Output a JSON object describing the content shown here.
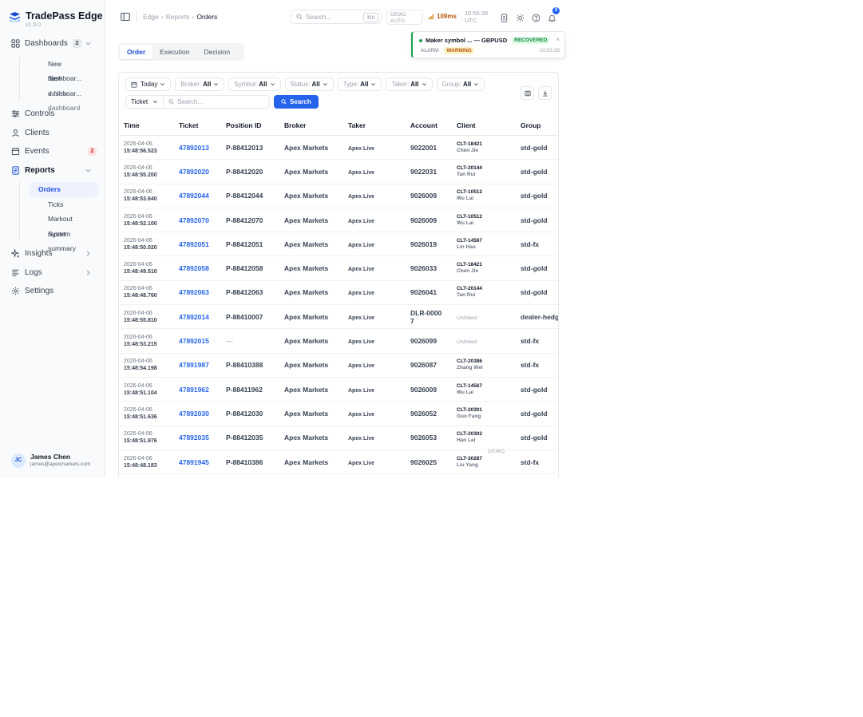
{
  "app": {
    "name": "TradePass Edge",
    "version": "v1.0.0",
    "accent": "#2563eb"
  },
  "sidebar": {
    "dashboards": {
      "label": "Dashboards",
      "badge": "2",
      "icon": "grid-icon",
      "items": [
        "New dashboar...",
        "New dashboar...",
        "+ New dashboard"
      ]
    },
    "items": [
      {
        "label": "Controls",
        "icon": "sliders-icon"
      },
      {
        "label": "Clients",
        "icon": "user-icon"
      },
      {
        "label": "Events",
        "icon": "calendar-icon",
        "badge": "2"
      }
    ],
    "reports": {
      "label": "Reports",
      "icon": "document-icon",
      "items": [
        "Orders",
        "Ticks",
        "Markout report",
        "System summary"
      ],
      "active": "Orders"
    },
    "bottom_items": [
      {
        "label": "Insights",
        "icon": "sparkle-icon"
      },
      {
        "label": "Logs",
        "icon": "list-icon"
      },
      {
        "label": "Settings",
        "icon": "gear-icon"
      }
    ],
    "user": {
      "initials": "JC",
      "name": "James Chen",
      "email": "james@apexmarkets.com"
    }
  },
  "topbar": {
    "breadcrumb": [
      "Edge",
      "Reports",
      "Orders"
    ],
    "search_placeholder": "Search...",
    "search_shortcut": "⌘K",
    "mode_line1": "DEMO ·",
    "mode_line2": "AUTO",
    "latency": "109ms",
    "clock_time": "10:56:38",
    "clock_zone": "UTC",
    "notification_count": "3"
  },
  "toast": {
    "title": "Maker symbol ... — GBPUSD",
    "status": "RECOVERED",
    "type": "ALARM",
    "severity": "WARNING",
    "time": "10:53:28",
    "close": "×"
  },
  "tabs": [
    "Order",
    "Execution",
    "Decision"
  ],
  "active_tab": "Order",
  "filters": {
    "date": "Today",
    "chips": [
      {
        "label": "Broker:",
        "value": "All"
      },
      {
        "label": "Symbol:",
        "value": "All"
      },
      {
        "label": "Status:",
        "value": "All"
      },
      {
        "label": "Type:",
        "value": "All"
      },
      {
        "label": "Taker:",
        "value": "All"
      },
      {
        "label": "Group:",
        "value": "All"
      }
    ],
    "search_field": "Ticket",
    "search_placeholder": "Search...",
    "search_button": "Search"
  },
  "table": {
    "columns": [
      "Time",
      "Ticket",
      "Position ID",
      "Broker",
      "Taker",
      "Account",
      "Client",
      "Group"
    ],
    "rows": [
      {
        "date": "2026-04-06",
        "time": "15:48:56.523",
        "ticket": "47892013",
        "position": "P-88412013",
        "broker": "Apex Markets",
        "taker": "Apex Live",
        "account": "9022001",
        "client_id": "CLT-18421",
        "client_name": "Chen Jie",
        "group": "std-gold"
      },
      {
        "date": "2026-04-06",
        "time": "15:48:55.200",
        "ticket": "47892020",
        "position": "P-88412020",
        "broker": "Apex Markets",
        "taker": "Apex Live",
        "account": "9022031",
        "client_id": "CLT-20144",
        "client_name": "Tan Rui",
        "group": "std-gold"
      },
      {
        "date": "2026-04-06",
        "time": "15:48:53.640",
        "ticket": "47892044",
        "position": "P-88412044",
        "broker": "Apex Markets",
        "taker": "Apex Live",
        "account": "9026009",
        "client_id": "CLT-10512",
        "client_name": "Wu Lai",
        "group": "std-gold"
      },
      {
        "date": "2026-04-06",
        "time": "15:48:52.100",
        "ticket": "47892070",
        "position": "P-88412070",
        "broker": "Apex Markets",
        "taker": "Apex Live",
        "account": "9026009",
        "client_id": "CLT-10512",
        "client_name": "Wu Lai",
        "group": "std-gold"
      },
      {
        "date": "2026-04-06",
        "time": "15:48:50.020",
        "ticket": "47892051",
        "position": "P-88412051",
        "broker": "Apex Markets",
        "taker": "Apex Live",
        "account": "9026019",
        "client_id": "CLT-14567",
        "client_name": "Lin Hao",
        "group": "std-fx"
      },
      {
        "date": "2026-04-06",
        "time": "15:48:49.510",
        "ticket": "47892058",
        "position": "P-88412058",
        "broker": "Apex Markets",
        "taker": "Apex Live",
        "account": "9026033",
        "client_id": "CLT-18421",
        "client_name": "Chen Jie",
        "group": "std-gold"
      },
      {
        "date": "2026-04-06",
        "time": "15:48:48.760",
        "ticket": "47892063",
        "position": "P-88412063",
        "broker": "Apex Markets",
        "taker": "Apex Live",
        "account": "9026041",
        "client_id": "CLT-20144",
        "client_name": "Tan Rui",
        "group": "std-gold"
      },
      {
        "date": "2026-04-06",
        "time": "15:48:55.810",
        "ticket": "47892014",
        "position": "P-88410007",
        "broker": "Apex Markets",
        "taker": "Apex Live",
        "account": "DLR-00007",
        "client_id": "",
        "client_name": "",
        "unlinked": "Unlinked",
        "group": "dealer-hedge"
      },
      {
        "date": "2026-04-06",
        "time": "15:48:53.215",
        "ticket": "47892015",
        "position": "—",
        "broker": "Apex Markets",
        "taker": "Apex Live",
        "account": "9026099",
        "client_id": "",
        "client_name": "",
        "unlinked": "Unlinked",
        "group": "std-fx"
      },
      {
        "date": "2026-04-06",
        "time": "15:48:54.198",
        "ticket": "47891987",
        "position": "P-88410388",
        "broker": "Apex Markets",
        "taker": "Apex Live",
        "account": "9026087",
        "client_id": "CLT-20386",
        "client_name": "Zhang Wei",
        "group": "std-fx"
      },
      {
        "date": "2026-04-06",
        "time": "15:48:51.104",
        "ticket": "47891962",
        "position": "P-88411962",
        "broker": "Apex Markets",
        "taker": "Apex Live",
        "account": "9026009",
        "client_id": "CLT-14567",
        "client_name": "Wu Lai",
        "group": "std-gold"
      },
      {
        "date": "2026-04-06",
        "time": "15:48:51.636",
        "ticket": "47892030",
        "position": "P-88412030",
        "broker": "Apex Markets",
        "taker": "Apex Live",
        "account": "9026052",
        "client_id": "CLT-20301",
        "client_name": "Guo Fang",
        "group": "std-gold"
      },
      {
        "date": "2026-04-06",
        "time": "15:48:51.976",
        "ticket": "47892035",
        "position": "P-88412035",
        "broker": "Apex Markets",
        "taker": "Apex Live",
        "account": "9026053",
        "client_id": "CLT-20302",
        "client_name": "Han Lei",
        "group": "std-gold"
      },
      {
        "date": "2026-04-06",
        "time": "15:48:48.183",
        "ticket": "47891945",
        "position": "P-88410386",
        "broker": "Apex Markets",
        "taker": "Apex Live",
        "account": "9026025",
        "client_id": "CLT-30287",
        "client_name": "Liu Yang",
        "group": "std-fx"
      },
      {
        "date": "2026-04-06",
        "time": "",
        "ticket": "",
        "position": "",
        "broker": "",
        "taker": "",
        "account": "",
        "client_id": "CLT-10298",
        "client_name": "",
        "group": ""
      }
    ]
  },
  "demo_tag": "DEMO"
}
